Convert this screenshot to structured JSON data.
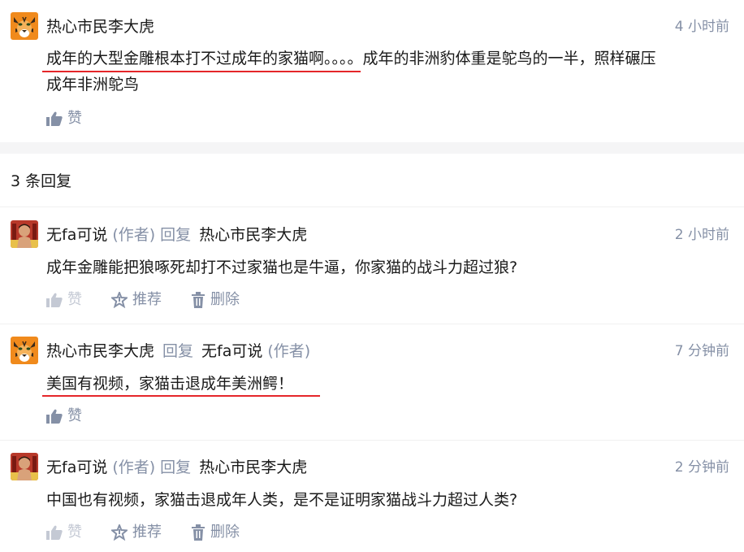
{
  "main_comment": {
    "author": "热心市民李大虎",
    "time": "4 小时前",
    "text_line1_underlined": "成年的大型金雕根本打不过成年的家猫啊。",
    "text_line1_rest": "。。。成年的非洲豹体重是鸵鸟的一半，照样碾压",
    "text_line2": "成年非洲鸵鸟",
    "like_label": "赞"
  },
  "reply_section": {
    "count_label": "3 条回复"
  },
  "replies": [
    {
      "author": "无fa可说",
      "author_tag": "(作者)",
      "reply_word": "回复",
      "target": "热心市民李大虎",
      "target_tag": "",
      "time": "2 小时前",
      "text": "成年金雕能把狼啄死却打不过家猫也是牛逼，你家猫的战斗力超过狼?",
      "like_label": "赞",
      "recommend_label": "推荐",
      "delete_label": "删除"
    },
    {
      "author": "热心市民李大虎",
      "author_tag": "",
      "reply_word": "回复",
      "target": "无fa可说",
      "target_tag": "(作者)",
      "time": "7 分钟前",
      "text": "美国有视频，家猫击退成年美洲鳄！",
      "like_label": "赞"
    },
    {
      "author": "无fa可说",
      "author_tag": "(作者)",
      "reply_word": "回复",
      "target": "热心市民李大虎",
      "target_tag": "",
      "time": "2 分钟前",
      "text": "中国也有视频，家猫击退成年人类，是不是证明家猫战斗力超过人类?",
      "like_label": "赞",
      "recommend_label": "推荐",
      "delete_label": "删除"
    }
  ],
  "colors": {
    "accent_underline": "#e5262a",
    "muted_text": "#8590a6",
    "tiger_orange": "#f08a1c"
  }
}
